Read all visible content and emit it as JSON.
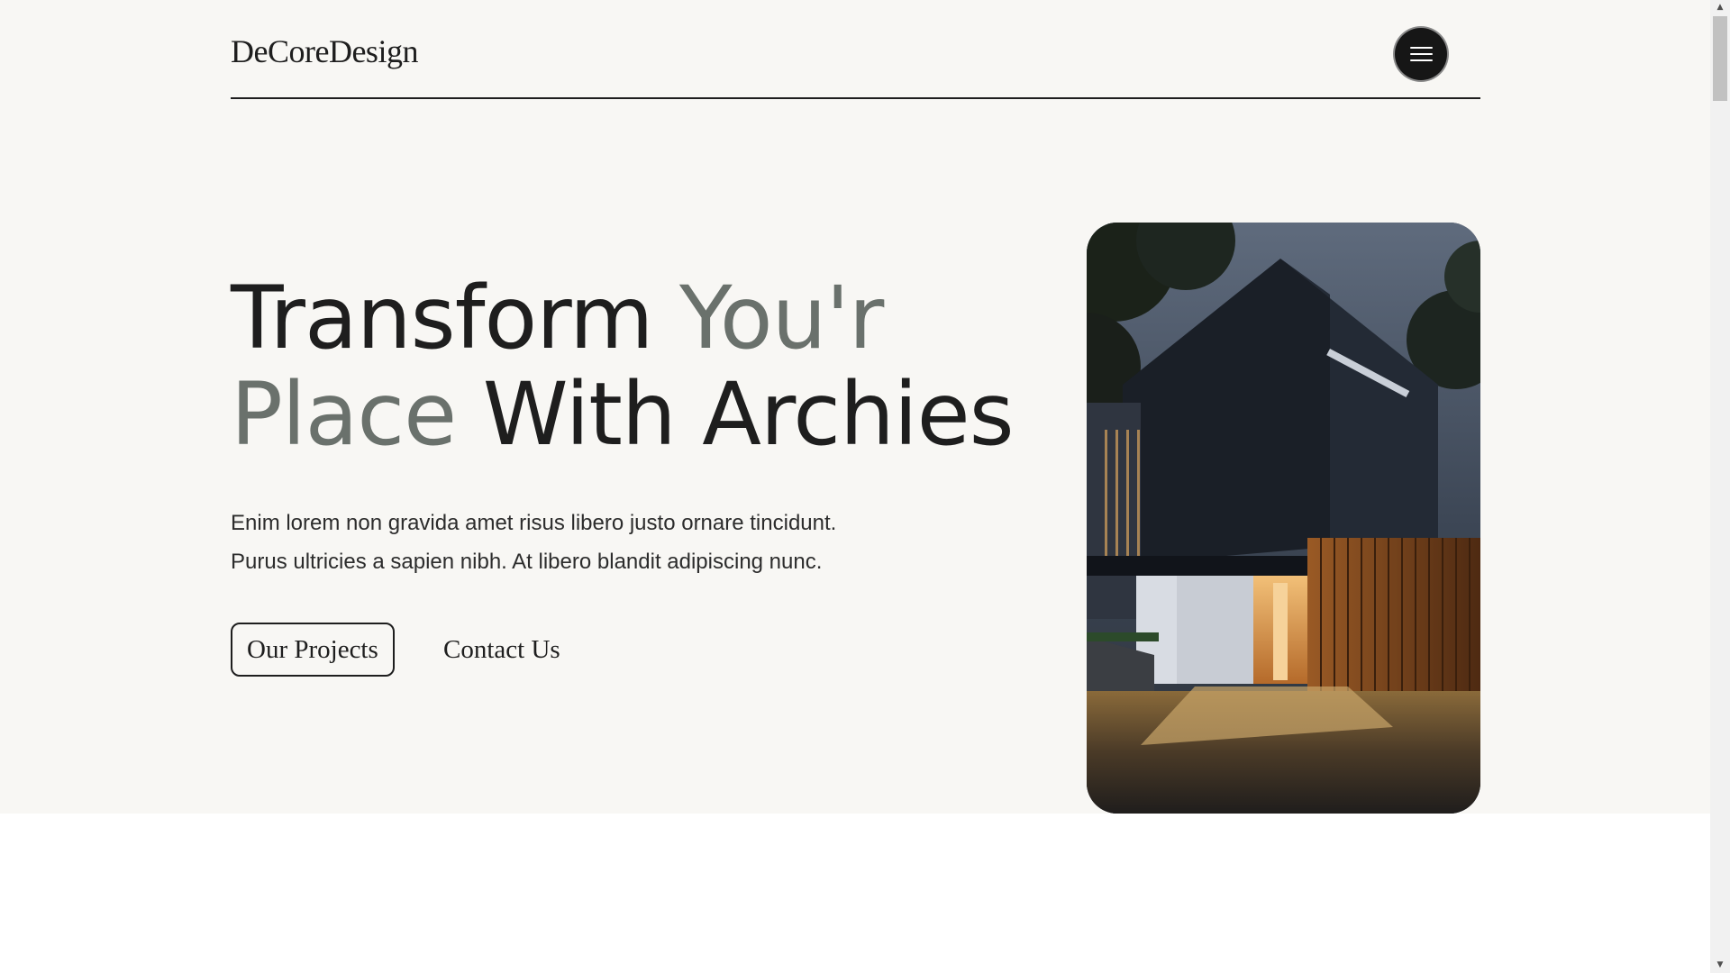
{
  "brand": {
    "logo_text": "DeCoreDesign"
  },
  "nav": {
    "menu_icon": "hamburger-menu-icon"
  },
  "hero": {
    "title_part1": "Transform ",
    "title_part2": "You'r",
    "title_part3": "Place",
    "title_part4": " With Archies",
    "description_line1": "Enim lorem non gravida amet risus libero justo ornare tincidunt.",
    "description_line2": "Purus ultricies a sapien nibh. At libero blandit adipiscing nunc.",
    "primary_button": "Our Projects",
    "secondary_button": "Contact Us",
    "image_subject": "modern-house-photo"
  },
  "colors": {
    "background": "#f8f7f4",
    "text_dark": "#1e1e1e",
    "accent_gray": "#6a716c",
    "menu_button": "#161616"
  },
  "scrollbar": {
    "up_icon": "scroll-up-arrow-icon",
    "down_icon": "scroll-down-arrow-icon"
  }
}
